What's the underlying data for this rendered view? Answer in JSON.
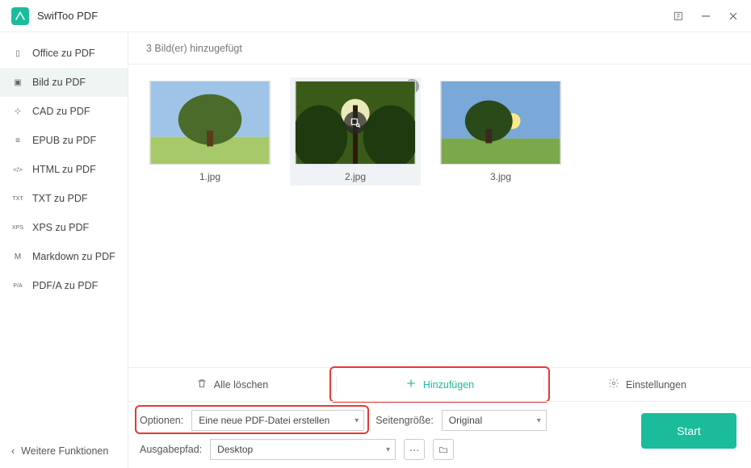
{
  "app": {
    "title": "SwifToo PDF"
  },
  "sidebar": {
    "items": [
      {
        "label": "Office zu PDF",
        "icon": "doc"
      },
      {
        "label": "Bild zu PDF",
        "icon": "img"
      },
      {
        "label": "CAD zu PDF",
        "icon": "cad"
      },
      {
        "label": "EPUB zu PDF",
        "icon": "epub"
      },
      {
        "label": "HTML zu PDF",
        "icon": "html"
      },
      {
        "label": "TXT zu PDF",
        "icon": "txt"
      },
      {
        "label": "XPS zu PDF",
        "icon": "xps"
      },
      {
        "label": "Markdown zu PDF",
        "icon": "md"
      },
      {
        "label": "PDF/A zu PDF",
        "icon": "pdfa"
      }
    ],
    "more": "Weitere Funktionen"
  },
  "status": "3 Bild(er) hinzugefügt",
  "thumbs": [
    {
      "label": "1.jpg"
    },
    {
      "label": "2.jpg"
    },
    {
      "label": "3.jpg"
    }
  ],
  "actions": {
    "delete_all": "Alle löschen",
    "add": "Hinzufügen",
    "settings": "Einstellungen"
  },
  "form": {
    "options_label": "Optionen:",
    "options_value": "Eine neue PDF-Datei erstellen",
    "size_label": "Seitengröße:",
    "size_value": "Original",
    "output_label": "Ausgabepfad:",
    "output_value": "Desktop",
    "start": "Start"
  },
  "icon_glyphs": {
    "doc": "▯",
    "img": "▣",
    "cad": "⊹",
    "epub": "≡",
    "html": "</>",
    "txt": "TXT",
    "xps": "XPS",
    "md": "M",
    "pdfa": "P/A"
  }
}
